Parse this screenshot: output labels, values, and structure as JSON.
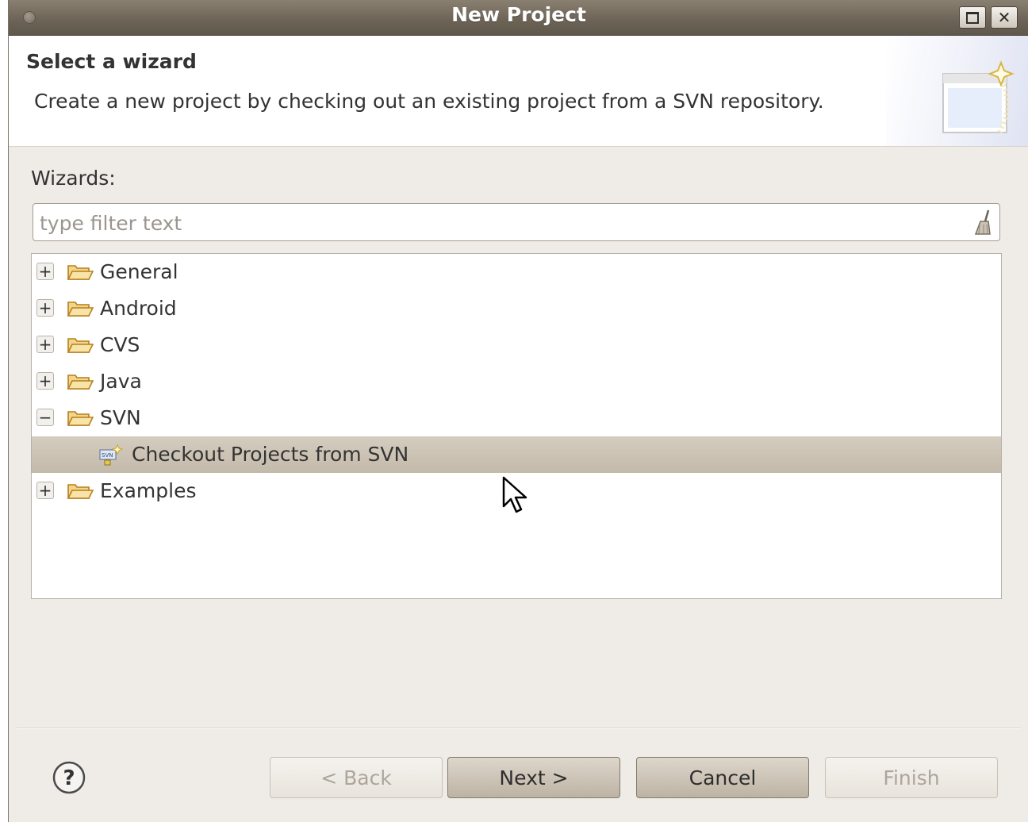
{
  "window": {
    "title": "New Project"
  },
  "header": {
    "title": "Select a wizard",
    "description": "Create a new project by checking out an existing project from a SVN repository."
  },
  "wizards": {
    "label": "Wizards:",
    "filter_placeholder": "type filter text",
    "filter_value": ""
  },
  "tree": {
    "items": [
      {
        "label": "General",
        "expanded": false,
        "icon": "folder-open-icon"
      },
      {
        "label": "Android",
        "expanded": false,
        "icon": "folder-open-icon"
      },
      {
        "label": "CVS",
        "expanded": false,
        "icon": "folder-open-icon"
      },
      {
        "label": "Java",
        "expanded": false,
        "icon": "folder-open-icon"
      },
      {
        "label": "SVN",
        "expanded": true,
        "icon": "folder-open-icon",
        "children": [
          {
            "label": "Checkout Projects from SVN",
            "selected": true,
            "icon": "svn-checkout-icon"
          }
        ]
      },
      {
        "label": "Examples",
        "expanded": false,
        "icon": "folder-open-icon"
      }
    ]
  },
  "buttons": {
    "back": "< Back",
    "next": "Next >",
    "cancel": "Cancel",
    "finish": "Finish"
  },
  "colors": {
    "titlebar": "#6e6558",
    "dialog_bg": "#efebe7",
    "selection": "#c8bfb1",
    "folder": "#e8a735"
  }
}
